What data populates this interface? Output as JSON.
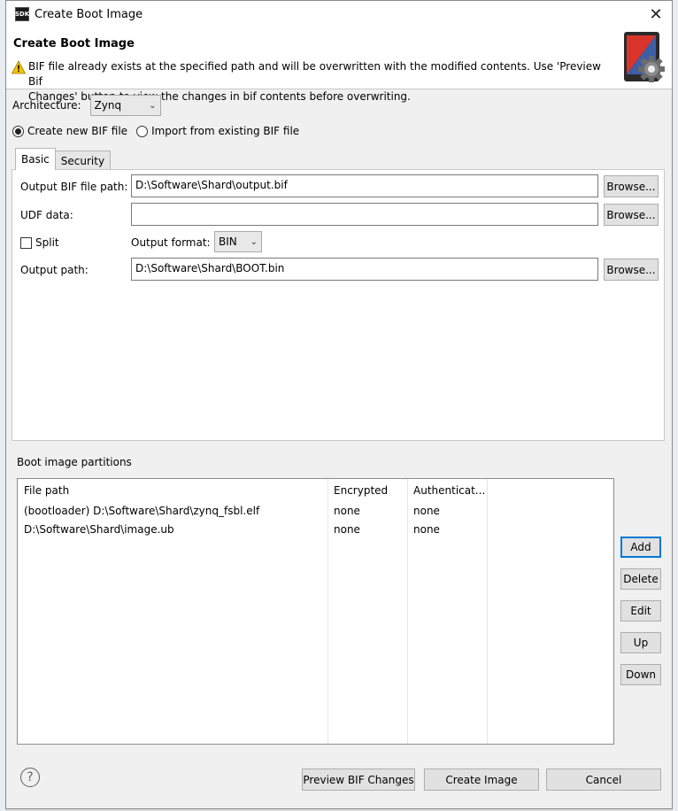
{
  "window": {
    "title": "Create Boot Image",
    "app_badge": "SDK",
    "close_glyph": "✕"
  },
  "header": {
    "title": "Create Boot Image",
    "warning_line1": "BIF file already exists at the specified path and will be overwritten with the modified contents. Use 'Preview Bif",
    "warning_line2": "Changes' button to view the changes in bif contents before overwriting."
  },
  "architecture": {
    "label": "Architecture:",
    "value": "Zynq"
  },
  "bif_mode": {
    "create_label": "Create new BIF file",
    "import_label": "Import from existing BIF file",
    "selected": "create"
  },
  "tabs": [
    {
      "label": "Basic",
      "active": true
    },
    {
      "label": "Security",
      "active": false
    }
  ],
  "basic": {
    "output_bif_label": "Output BIF file path:",
    "output_bif_value": "D:\\Software\\Shard\\output.bif",
    "udf_label": "UDF data:",
    "udf_value": "",
    "split_label": "Split",
    "split_checked": false,
    "output_format_label": "Output format:",
    "output_format_value": "BIN",
    "output_path_label": "Output path:",
    "output_path_value": "D:\\Software\\Shard\\BOOT.bin",
    "browse_label": "Browse..."
  },
  "partitions": {
    "label": "Boot image partitions",
    "columns": [
      "File path",
      "Encrypted",
      "Authenticat..."
    ],
    "rows": [
      [
        "(bootloader) D:\\Software\\Shard\\zynq_fsbl.elf",
        "none",
        "none"
      ],
      [
        "D:\\Software\\Shard\\image.ub",
        "none",
        "none"
      ]
    ],
    "buttons": {
      "add": "Add",
      "delete": "Delete",
      "edit": "Edit",
      "up": "Up",
      "down": "Down"
    }
  },
  "footer": {
    "help_glyph": "?",
    "preview": "Preview BIF Changes",
    "create": "Create Image",
    "cancel": "Cancel"
  },
  "colors": {
    "accent_focus": "#0078d7",
    "warning": "#f5c400"
  },
  "icons": [
    "sdk-app-icon",
    "close-icon",
    "warning-icon",
    "boot-image-gear-icon",
    "chevron-down-icon",
    "help-icon"
  ]
}
